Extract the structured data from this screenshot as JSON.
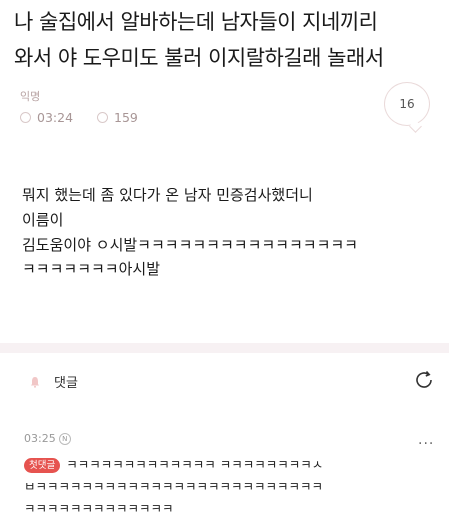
{
  "post": {
    "title_line1": "나 술집에서 알바하는데 남자들이 지네끼리",
    "title_line2": "와서 야 도우미도 불러 이지랄하길래 놀래서",
    "author": "익명",
    "time": "03:24",
    "views": "159",
    "comment_count": "16",
    "body_lines": [
      "뭐지 했는데 좀 있다가 온 남자 민증검사했더니",
      "이름이",
      "김도움이야 ㅇ시발ㅋㅋㅋㅋㅋㅋㅋㅋㅋㅋㅋㅋㅋㅋㅋㅋ",
      "ㅋㅋㅋㅋㅋㅋㅋ아시발"
    ]
  },
  "comments": {
    "header_label": "댓글",
    "items": [
      {
        "time": "03:25",
        "new_mark": "N",
        "badge": "첫댓글",
        "line1": "ㅋㅋㅋㅋㅋㅋㅋㅋㅋㅋㅋㅋㅋ ㅋㅋㅋㅋㅋㅋㅋㅋㅅ",
        "line2": "ㅂㅋㅋㅋㅋㅋㅋㅋㅋㅋㅋㅋㅋㅋㅋㅋㅋㅋㅋㅋㅋㅋㅋㅋㅋㅋ",
        "line3": "ㅋㅋㅋㅋㅋㅋㅋㅋㅋㅋㅋㅋㅋ"
      }
    ]
  },
  "icons": {
    "time": "clock-icon",
    "views": "eye-icon",
    "comments": "speech-bubble-icon",
    "comment_header": "bell-icon",
    "refresh": "refresh-icon",
    "more": "more-icon"
  },
  "colors": {
    "badge": "#e6534f",
    "divider": "#f7f1f3",
    "meta": "#a89696"
  }
}
